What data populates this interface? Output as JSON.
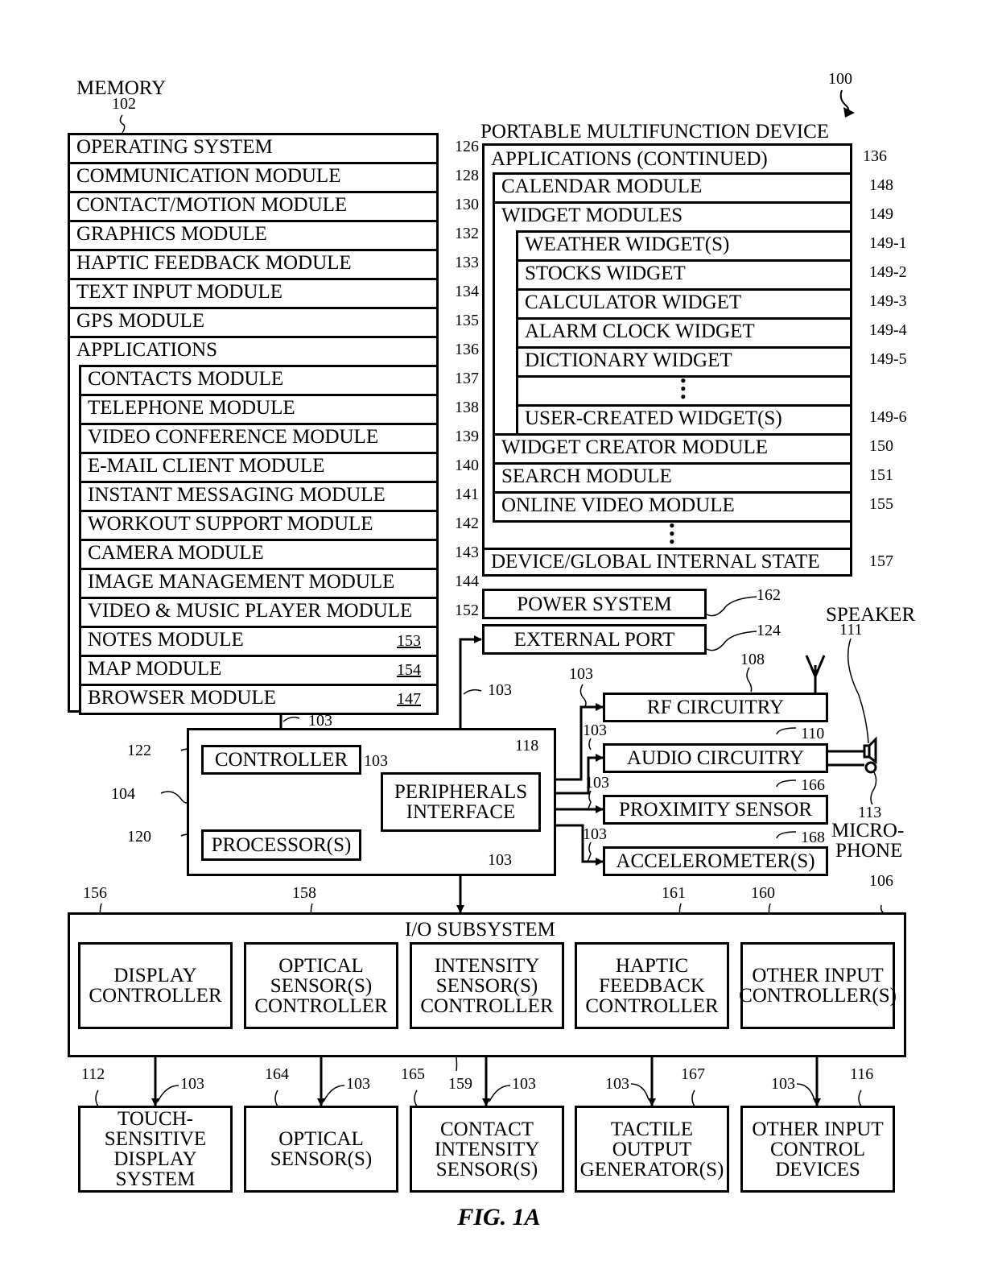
{
  "device": {
    "title": "PORTABLE MULTIFUNCTION DEVICE",
    "ref": "100"
  },
  "memory": {
    "title": "MEMORY",
    "ref": "102",
    "rows": [
      {
        "label": "OPERATING SYSTEM",
        "ref": "126"
      },
      {
        "label": "COMMUNICATION MODULE",
        "ref": "128"
      },
      {
        "label": "CONTACT/MOTION MODULE",
        "ref": "130"
      },
      {
        "label": "GRAPHICS MODULE",
        "ref": "132"
      },
      {
        "label": "HAPTIC FEEDBACK MODULE",
        "ref": "133"
      },
      {
        "label": "TEXT INPUT MODULE",
        "ref": "134"
      },
      {
        "label": "GPS MODULE",
        "ref": "135"
      },
      {
        "label": "APPLICATIONS",
        "ref": "136"
      }
    ],
    "apps": [
      {
        "label": "CONTACTS MODULE",
        "ref": "137"
      },
      {
        "label": "TELEPHONE MODULE",
        "ref": "138"
      },
      {
        "label": "VIDEO CONFERENCE MODULE",
        "ref": "139"
      },
      {
        "label": "E-MAIL CLIENT MODULE",
        "ref": "140"
      },
      {
        "label": "INSTANT MESSAGING MODULE",
        "ref": "141"
      },
      {
        "label": "WORKOUT SUPPORT MODULE",
        "ref": "142"
      },
      {
        "label": "CAMERA MODULE",
        "ref": "143"
      },
      {
        "label": "IMAGE MANAGEMENT MODULE",
        "ref": "144"
      },
      {
        "label": "VIDEO & MUSIC PLAYER MODULE",
        "ref": "152"
      },
      {
        "label": "NOTES MODULE",
        "inline_ref": "153"
      },
      {
        "label": "MAP MODULE",
        "inline_ref": "154"
      },
      {
        "label": "BROWSER MODULE",
        "inline_ref": "147"
      }
    ]
  },
  "apps_continued": {
    "title": "APPLICATIONS (CONTINUED)",
    "ref": "136",
    "calendar": {
      "label": "CALENDAR MODULE",
      "ref": "148"
    },
    "widgets": {
      "label": "WIDGET MODULES",
      "ref": "149"
    },
    "widget_items": [
      {
        "label": "WEATHER WIDGET(S)",
        "ref": "149-1"
      },
      {
        "label": "STOCKS WIDGET",
        "ref": "149-2"
      },
      {
        "label": "CALCULATOR WIDGET",
        "ref": "149-3"
      },
      {
        "label": "ALARM CLOCK WIDGET",
        "ref": "149-4"
      },
      {
        "label": "DICTIONARY WIDGET",
        "ref": "149-5"
      },
      {
        "label": "USER-CREATED WIDGET(S)",
        "ref": "149-6"
      }
    ],
    "more": [
      {
        "label": "WIDGET CREATOR MODULE",
        "ref": "150"
      },
      {
        "label": "SEARCH MODULE",
        "ref": "151"
      },
      {
        "label": "ONLINE VIDEO MODULE",
        "ref": "155"
      }
    ],
    "state": {
      "label": "DEVICE/GLOBAL INTERNAL STATE",
      "ref": "157"
    }
  },
  "power": {
    "label": "POWER SYSTEM",
    "ref": "162"
  },
  "port": {
    "label": "EXTERNAL PORT",
    "ref": "124"
  },
  "chip": {
    "ref": "104",
    "controller": {
      "label": "CONTROLLER",
      "ref": "122"
    },
    "processor": {
      "label": "PROCESSOR(S)",
      "ref": "120"
    },
    "peripherals": {
      "line1": "PERIPHERALS",
      "line2": "INTERFACE",
      "ref": "118"
    }
  },
  "bus_ref": "103",
  "peripherals_right": [
    {
      "label": "RF CIRCUITRY",
      "ref": "108"
    },
    {
      "label": "AUDIO CIRCUITRY",
      "ref": "110"
    },
    {
      "label": "PROXIMITY SENSOR",
      "ref": "166"
    },
    {
      "label": "ACCELEROMETER(S)",
      "ref": "168"
    }
  ],
  "speaker": {
    "label": "SPEAKER",
    "ref": "111"
  },
  "microphone": {
    "line1": "MICRO-",
    "line2": "PHONE",
    "ref": "113"
  },
  "io": {
    "title": "I/O SUBSYSTEM",
    "ref": "106",
    "controllers": [
      {
        "lines": [
          "DISPLAY",
          "CONTROLLER"
        ],
        "ref": "156"
      },
      {
        "lines": [
          "OPTICAL",
          "SENSOR(S)",
          "CONTROLLER"
        ],
        "ref": "158"
      },
      {
        "lines": [
          "INTENSITY",
          "SENSOR(S)",
          "CONTROLLER"
        ],
        "ref": "159"
      },
      {
        "lines": [
          "HAPTIC",
          "FEEDBACK",
          "CONTROLLER"
        ],
        "ref": "161"
      },
      {
        "lines": [
          "OTHER INPUT",
          "CONTROLLER(S)"
        ],
        "ref": "160"
      }
    ],
    "devices": [
      {
        "lines": [
          "TOUCH-",
          "SENSITIVE",
          "DISPLAY",
          "SYSTEM"
        ],
        "ref": "112"
      },
      {
        "lines": [
          "OPTICAL",
          "SENSOR(S)"
        ],
        "ref": "164"
      },
      {
        "lines": [
          "CONTACT",
          "INTENSITY",
          "SENSOR(S)"
        ],
        "ref": "165"
      },
      {
        "lines": [
          "TACTILE",
          "OUTPUT",
          "GENERATOR(S)"
        ],
        "ref": "167"
      },
      {
        "lines": [
          "OTHER INPUT",
          "CONTROL",
          "DEVICES"
        ],
        "ref": "116"
      }
    ]
  },
  "caption": "FIG. 1A"
}
